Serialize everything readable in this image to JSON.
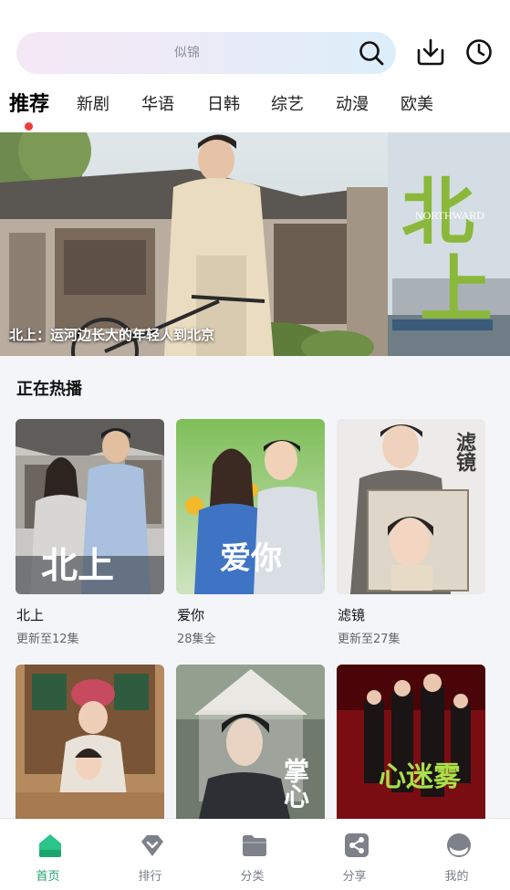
{
  "header": {
    "search_placeholder": "似锦",
    "search_icon": "search-icon",
    "download_icon": "download-icon",
    "history_icon": "clock-icon"
  },
  "tabs": [
    {
      "label": "推荐",
      "active": true
    },
    {
      "label": "新剧"
    },
    {
      "label": "华语"
    },
    {
      "label": "日韩"
    },
    {
      "label": "综艺"
    },
    {
      "label": "动漫"
    },
    {
      "label": "欧美"
    }
  ],
  "banner": {
    "caption": "北上：运河边长大的年轻人到北京",
    "art_title": "北上",
    "art_subtitle": "NORTHWARD"
  },
  "section": {
    "title": "正在热播"
  },
  "cards": [
    {
      "title": "北上",
      "subtitle": "更新至12集",
      "art_text": "北上"
    },
    {
      "title": "爱你",
      "subtitle": "28集全",
      "art_text": "爱你"
    },
    {
      "title": "滤镜",
      "subtitle": "更新至27集",
      "art_text": "滤镜"
    },
    {
      "title": "",
      "subtitle": ""
    },
    {
      "title": "",
      "subtitle": "",
      "art_text": "掌心"
    },
    {
      "title": "",
      "subtitle": "",
      "art_text": "心迷雾"
    }
  ],
  "bottom_nav": [
    {
      "label": "首页",
      "icon": "home-icon",
      "active": true
    },
    {
      "label": "排行",
      "icon": "ranking-icon"
    },
    {
      "label": "分类",
      "icon": "folder-icon"
    },
    {
      "label": "分享",
      "icon": "share-icon"
    },
    {
      "label": "我的",
      "icon": "profile-icon"
    }
  ],
  "colors": {
    "accent": "#22a06b",
    "tab_dot": "#f03b3b",
    "banner_title": "#8ab83a"
  }
}
